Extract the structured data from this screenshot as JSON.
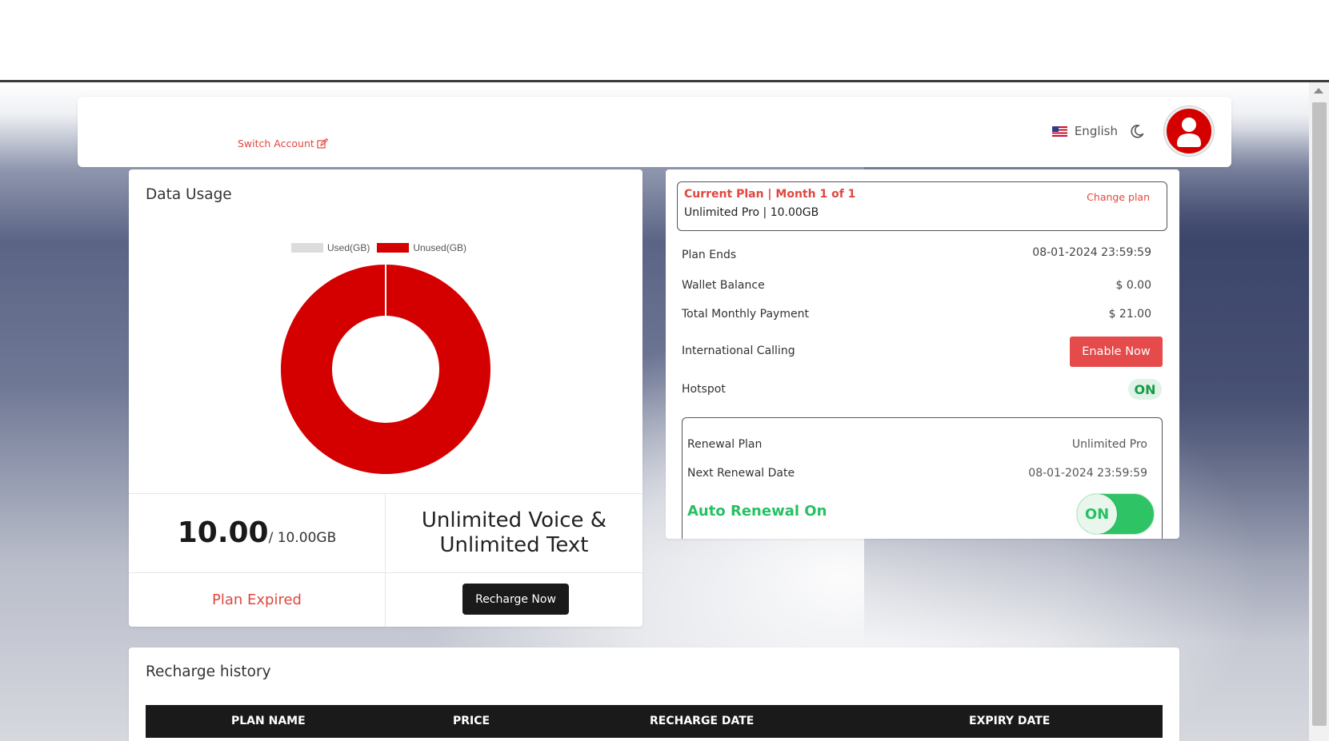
{
  "header": {
    "switch_account": "Switch Account",
    "language": "English",
    "icons": {
      "flag": "us-flag-icon",
      "theme": "moon-icon",
      "avatar": "user-avatar-icon",
      "edit": "edit-icon"
    }
  },
  "data_usage": {
    "title": "Data Usage",
    "legend": [
      {
        "label": "Used(GB)",
        "color": "#dcdcdc"
      },
      {
        "label": "Unused(GB)",
        "color": "#d40000"
      }
    ],
    "remaining": "10.00",
    "total": "/ 10.00GB",
    "voice_text_line1": "Unlimited Voice &",
    "voice_text_line2": "Unlimited Text",
    "status": "Plan Expired",
    "recharge_button": "Recharge Now"
  },
  "chart_data": {
    "type": "pie",
    "categories": [
      "Used(GB)",
      "Unused(GB)"
    ],
    "values": [
      0,
      10
    ],
    "colors": [
      "#dcdcdc",
      "#d40000"
    ],
    "donut": true,
    "legend_position": "top"
  },
  "plan": {
    "current_label": "Current Plan | Month 1 of 1",
    "plan_name": "Unlimited Pro | 10.00GB",
    "change_plan": "Change plan",
    "rows": [
      {
        "label": "Plan Ends",
        "value": "08-01-2024 23:59:59"
      },
      {
        "label": "Wallet Balance",
        "value": "$ 0.00"
      },
      {
        "label": "Total Monthly Payment",
        "value": "$ 21.00"
      },
      {
        "label": "International Calling",
        "value": "Enable Now"
      },
      {
        "label": "Hotspot",
        "value": "ON"
      }
    ],
    "renewal": {
      "plan_label": "Renewal Plan",
      "plan_value": "Unlimited Pro",
      "date_label": "Next Renewal Date",
      "date_value": "08-01-2024 23:59:59",
      "auto_renewal": "Auto Renewal On",
      "toggle": "ON"
    }
  },
  "history": {
    "title": "Recharge history",
    "columns": [
      "PLAN NAME",
      "PRICE",
      "RECHARGE DATE",
      "EXPIRY DATE"
    ]
  }
}
